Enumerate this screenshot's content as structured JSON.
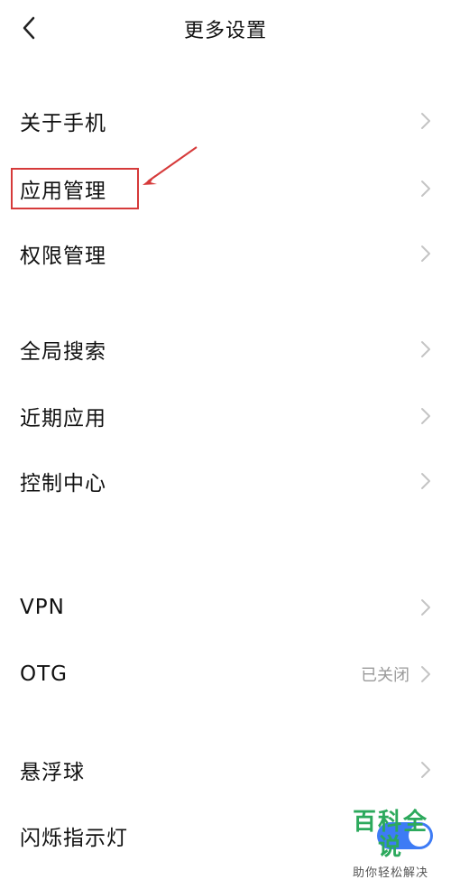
{
  "header": {
    "title": "更多设置"
  },
  "settings": {
    "about_phone": "关于手机",
    "app_management": "应用管理",
    "permission_management": "权限管理",
    "global_search": "全局搜索",
    "recent_apps": "近期应用",
    "control_center": "控制中心",
    "vpn": "VPN",
    "otg": "OTG",
    "otg_status": "已关闭",
    "floating_ball": "悬浮球",
    "flash_indicator": "闪烁指示灯",
    "flash_indicator_on": true
  },
  "watermark": {
    "title": "百科全说",
    "subtitle": "助你轻松解决"
  },
  "colors": {
    "highlight": "#d63a3a",
    "toggle_on": "#3d7bf5",
    "watermark_green": "#2ca95c"
  }
}
